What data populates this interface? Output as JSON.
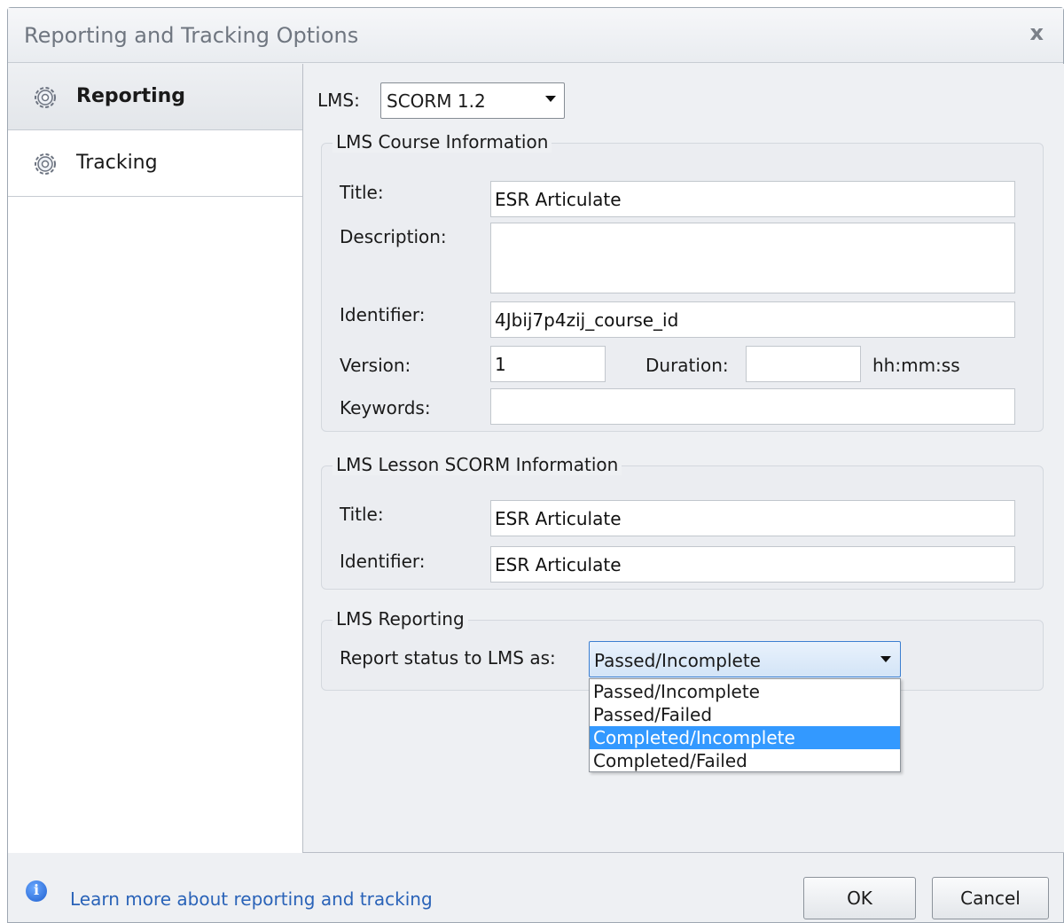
{
  "window": {
    "title": "Reporting and Tracking Options",
    "close_label": "x"
  },
  "sidebar": {
    "items": [
      {
        "label": "Reporting",
        "icon": "gear-icon",
        "active": true
      },
      {
        "label": "Tracking",
        "icon": "gear-icon",
        "active": false
      }
    ]
  },
  "lms": {
    "label": "LMS:",
    "selected": "SCORM 1.2"
  },
  "course_info": {
    "legend": "LMS Course Information",
    "title_label": "Title:",
    "title_value": "ESR Articulate",
    "description_label": "Description:",
    "description_value": "",
    "identifier_label": "Identifier:",
    "identifier_value": "4Jbij7p4zij_course_id",
    "version_label": "Version:",
    "version_value": "1",
    "duration_label": "Duration:",
    "duration_value": "",
    "duration_unit": "hh:mm:ss",
    "keywords_label": "Keywords:",
    "keywords_value": ""
  },
  "lesson_info": {
    "legend": "LMS Lesson SCORM Information",
    "title_label": "Title:",
    "title_value": "ESR Articulate",
    "identifier_label": "Identifier:",
    "identifier_value": "ESR Articulate"
  },
  "reporting": {
    "legend": "LMS Reporting",
    "status_label": "Report status to LMS as:",
    "status_selected": "Passed/Incomplete",
    "options": [
      "Passed/Incomplete",
      "Passed/Failed",
      "Completed/Incomplete",
      "Completed/Failed"
    ],
    "highlighted_option": "Completed/Incomplete"
  },
  "footer": {
    "help_link": "Learn more about reporting and tracking",
    "ok_label": "OK",
    "cancel_label": "Cancel"
  },
  "colors": {
    "accent": "#3399ff",
    "link": "#2a63b8"
  }
}
